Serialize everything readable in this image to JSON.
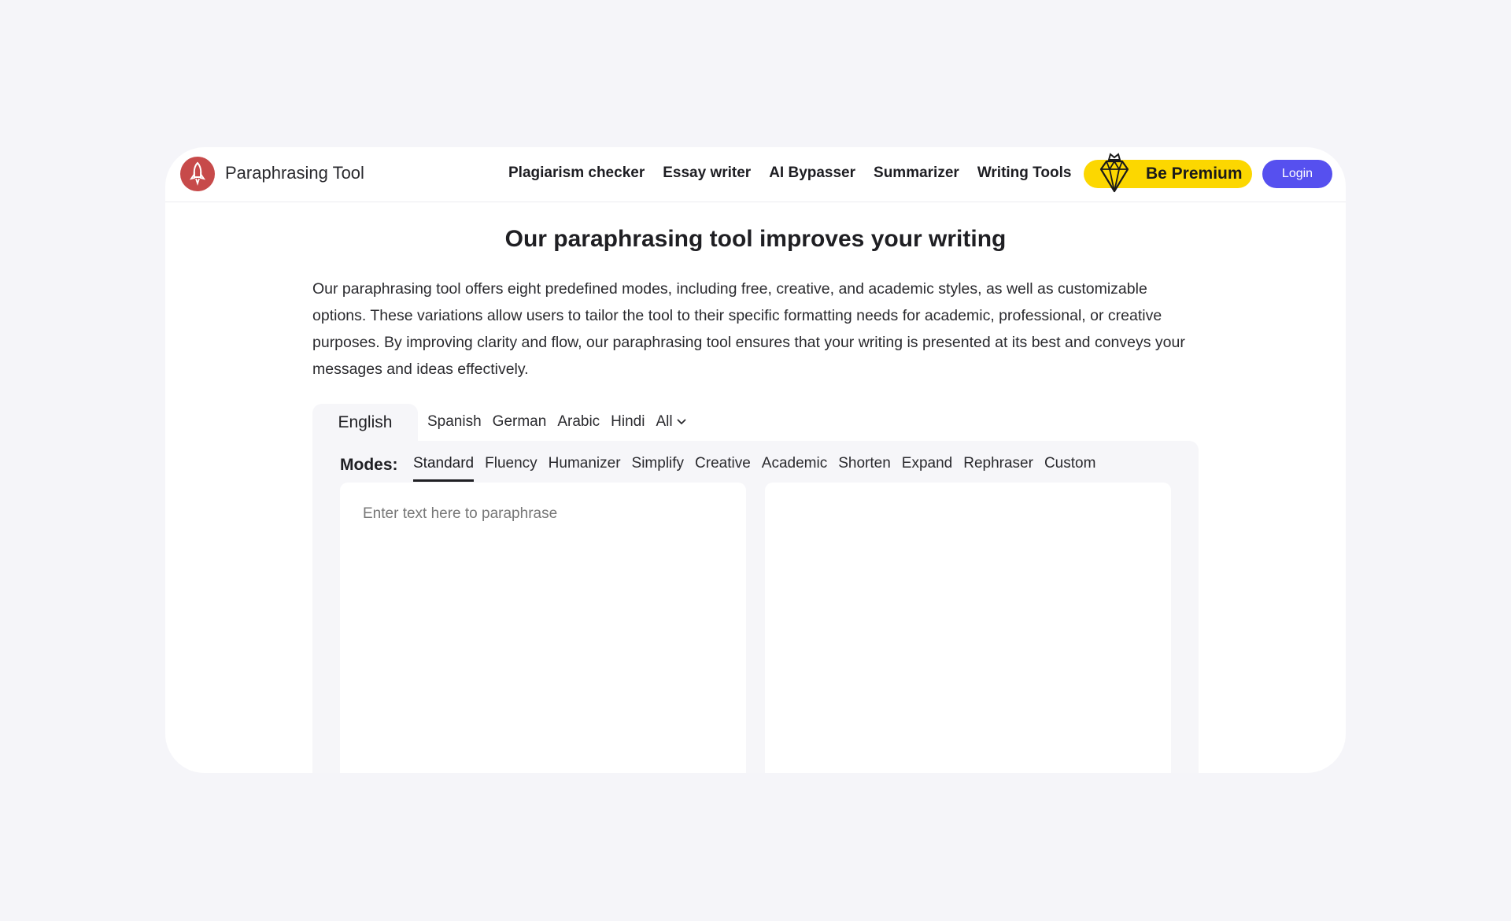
{
  "brand": {
    "name": "Paraphrasing Tool",
    "logo_icon": "rocket-icon",
    "logo_color": "#c74a4a"
  },
  "nav": {
    "items": [
      "Plagiarism checker",
      "Essay writer",
      "AI Bypasser",
      "Summarizer",
      "Writing Tools"
    ],
    "premium_label": "Be Premium",
    "premium_icon": "diamond-crown-icon",
    "premium_color": "#fcd700",
    "login_label": "Login",
    "login_color": "#5650ef"
  },
  "main": {
    "headline": "Our paraphrasing tool improves your writing",
    "description": "Our paraphrasing tool offers eight predefined modes, including free, creative, and academic styles, as well as customizable options. These variations allow users to tailor the tool to their specific formatting needs for academic, professional, or creative purposes. By improving clarity and flow, our paraphrasing tool ensures that your writing is presented at its best and conveys your messages and ideas effectively."
  },
  "languages": {
    "selected": "English",
    "options": [
      "Spanish",
      "German",
      "Arabic",
      "Hindi"
    ],
    "all_label": "All"
  },
  "modes": {
    "label": "Modes:",
    "selected": "Standard",
    "options": [
      "Standard",
      "Fluency",
      "Humanizer",
      "Simplify",
      "Creative",
      "Academic",
      "Shorten",
      "Expand",
      "Rephraser",
      "Custom"
    ]
  },
  "editor": {
    "input_placeholder": "Enter text here to paraphrase",
    "input_value": "",
    "output_value": ""
  }
}
